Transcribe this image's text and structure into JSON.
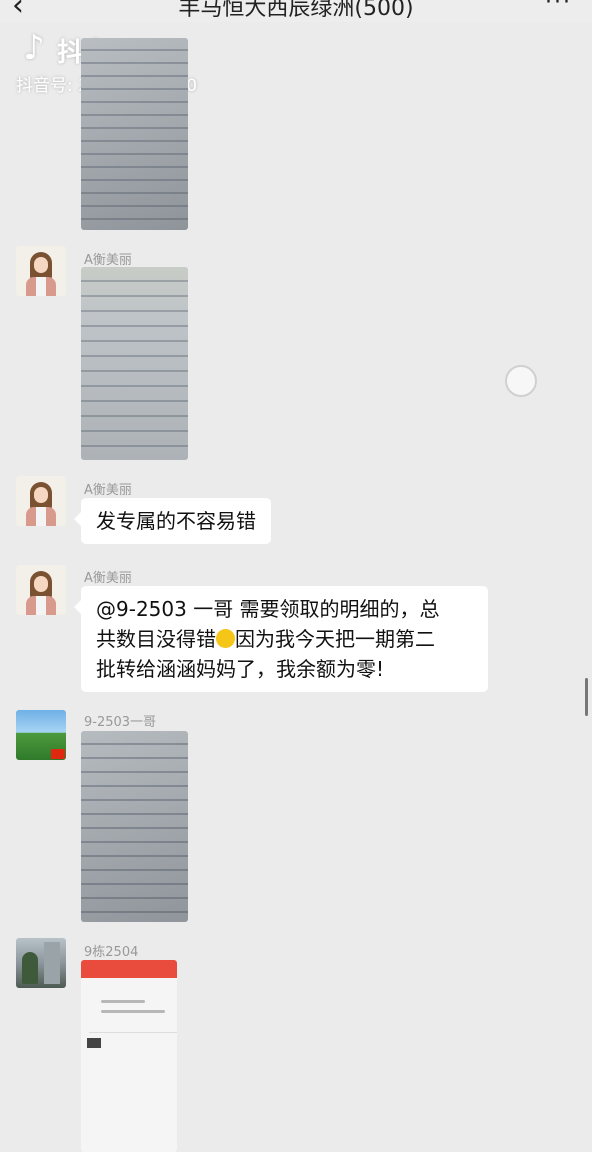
{
  "header": {
    "back_icon": "‹",
    "title": "丰马恒大西辰绿洲(500)",
    "more_icon": "···"
  },
  "watermark": {
    "logo": "♪",
    "app": "抖音",
    "account": "抖音号: 27536993840"
  },
  "messages": [
    {
      "type": "image",
      "sender": ""
    },
    {
      "type": "image",
      "sender": "A衡美丽"
    },
    {
      "type": "text",
      "sender": "A衡美丽",
      "lines": [
        "发专属的不容易错"
      ]
    },
    {
      "type": "text",
      "sender": "A衡美丽",
      "lines": [
        "@9-2503 一哥  需要领取的明细的，总",
        "共数目没得错",
        "因为我今天把一期第二",
        "批转给涵涵妈妈了，我余额为零!"
      ],
      "emoji": "smiley"
    },
    {
      "type": "image",
      "sender": "9-2503一哥"
    },
    {
      "type": "image",
      "sender": "9栋2504"
    }
  ]
}
